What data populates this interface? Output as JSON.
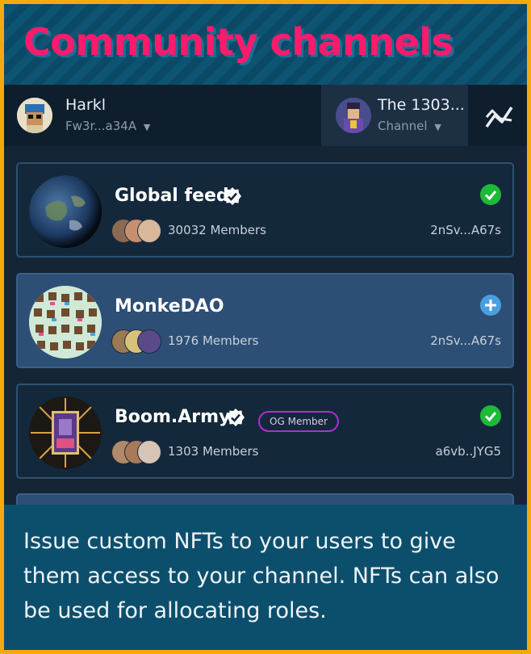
{
  "title": "Community channels",
  "user": {
    "name": "Harkl",
    "wallet": "Fw3r...a34A"
  },
  "channel_selector": {
    "name": "The 1303...",
    "subtitle": "Channel"
  },
  "channels": [
    {
      "name": "Global feed",
      "verified": true,
      "members": "30032 Members",
      "id": "2nSv...A67s",
      "status": "joined"
    },
    {
      "name": "MonkeDAO",
      "verified": false,
      "members": "1976 Members",
      "id": "2nSv...A67s",
      "status": "join"
    },
    {
      "name": "Boom.Army",
      "verified": true,
      "badge": "OG Member",
      "members": "1303 Members",
      "id": "a6vb..JYG5",
      "status": "joined"
    }
  ],
  "description": "Issue custom NFTs to your users to give them access to your channel. NFTs can also be used for allocating roles.",
  "colors": {
    "title": "#ff1a6b",
    "frame": "#f5a90c",
    "joined": "#1db938",
    "join": "#4a9fe0",
    "badge_border": "#b02cd8"
  }
}
